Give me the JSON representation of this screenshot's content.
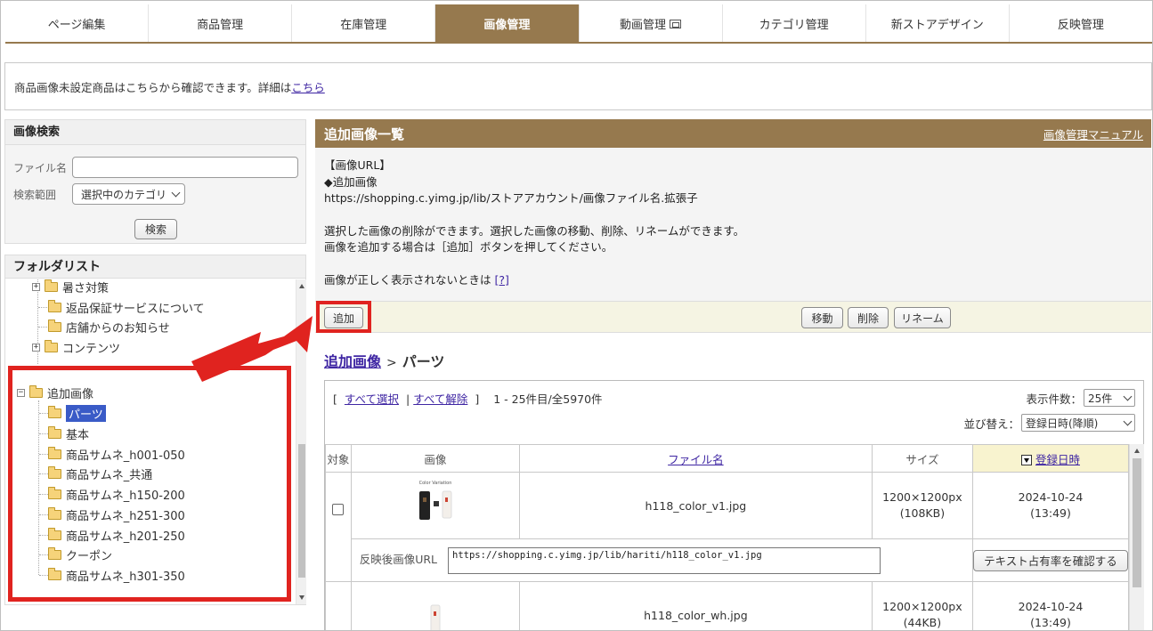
{
  "nav": {
    "tabs": [
      {
        "label": "ページ編集",
        "active": false
      },
      {
        "label": "商品管理",
        "active": false
      },
      {
        "label": "在庫管理",
        "active": false
      },
      {
        "label": "画像管理",
        "active": true
      },
      {
        "label": "動画管理",
        "active": false,
        "icon": "external-window-icon"
      },
      {
        "label": "カテゴリ管理",
        "active": false
      },
      {
        "label": "新ストアデザイン",
        "active": false
      },
      {
        "label": "反映管理",
        "active": false
      }
    ]
  },
  "notice": {
    "text": "商品画像未設定商品はこちらから確認できます。詳細は",
    "link": "こちら"
  },
  "search": {
    "title": "画像検索",
    "filename_label": "ファイル名",
    "filename_value": "",
    "scope_label": "検索範囲",
    "scope_value": "選択中のカテゴリ",
    "search_button": "検索"
  },
  "folders": {
    "title": "フォルダリスト",
    "top_items": [
      {
        "label": "暑さ対策",
        "expandable": true
      },
      {
        "label": "返品保証サービスについて",
        "expandable": false
      },
      {
        "label": "店舗からのお知らせ",
        "expandable": false
      },
      {
        "label": "コンテンツ",
        "expandable": true
      }
    ],
    "root": {
      "label": "追加画像",
      "expander": "−"
    },
    "children": [
      "パーツ",
      "基本",
      "商品サムネ_h001-050",
      "商品サムネ_共通",
      "商品サムネ_h150-200",
      "商品サムネ_h251-300",
      "商品サムネ_h201-250",
      "クーポン",
      "商品サムネ_h301-350"
    ],
    "selected": "パーツ"
  },
  "main": {
    "title": "追加画像一覧",
    "manual_link": "画像管理マニュアル",
    "desc_lines": [
      "【画像URL】",
      "◆追加画像",
      "https://shopping.c.yimg.jp/lib/ストアアカウント/画像ファイル名.拡張子",
      "",
      "選択した画像の削除ができます。選択した画像の移動、削除、リネームができます。",
      "画像を追加する場合は［追加］ボタンを押してください。",
      "",
      "画像が正しく表示されないときは "
    ],
    "help_link": "[?]",
    "add_button": "追加",
    "move_button": "移動",
    "delete_button": "削除",
    "rename_button": "リネーム"
  },
  "breadcrumb": {
    "parent": "追加画像",
    "separator": ">",
    "current": "パーツ"
  },
  "list": {
    "select_all": "すべて選択",
    "deselect_all": "すべて解除",
    "bracket_open": "[",
    "bracket_close": "]",
    "divider": "|",
    "range": "1 - 25件目/全5970件",
    "per_page_label": "表示件数：",
    "per_page_value": "25件",
    "sort_label": "並び替え：",
    "sort_value": "登録日時(降順)",
    "columns": {
      "target": "対象",
      "image": "画像",
      "filename": "ファイル名",
      "size": "サイズ",
      "date": "登録日時"
    },
    "url_label": "反映後画像URL",
    "check_button": "テキスト占有率を確認する",
    "rows": [
      {
        "filename": "h118_color_v1.jpg",
        "dims": "1200×1200px",
        "bytes": "(108KB)",
        "date": "2024-10-24",
        "time": "(13:49)",
        "url": "https://shopping.c.yimg.jp/lib/hariti/h118_color_v1.jpg",
        "thumb_caption": "Color Variation"
      },
      {
        "filename": "h118_color_wh.jpg",
        "dims": "1200×1200px",
        "bytes": "(44KB)",
        "date": "2024-10-24",
        "time": "(13:49)"
      }
    ]
  },
  "colors": {
    "accent": "#96794e",
    "link": "#3f26a3",
    "highlight": "#e0231f",
    "selected": "#3a5bc7"
  }
}
